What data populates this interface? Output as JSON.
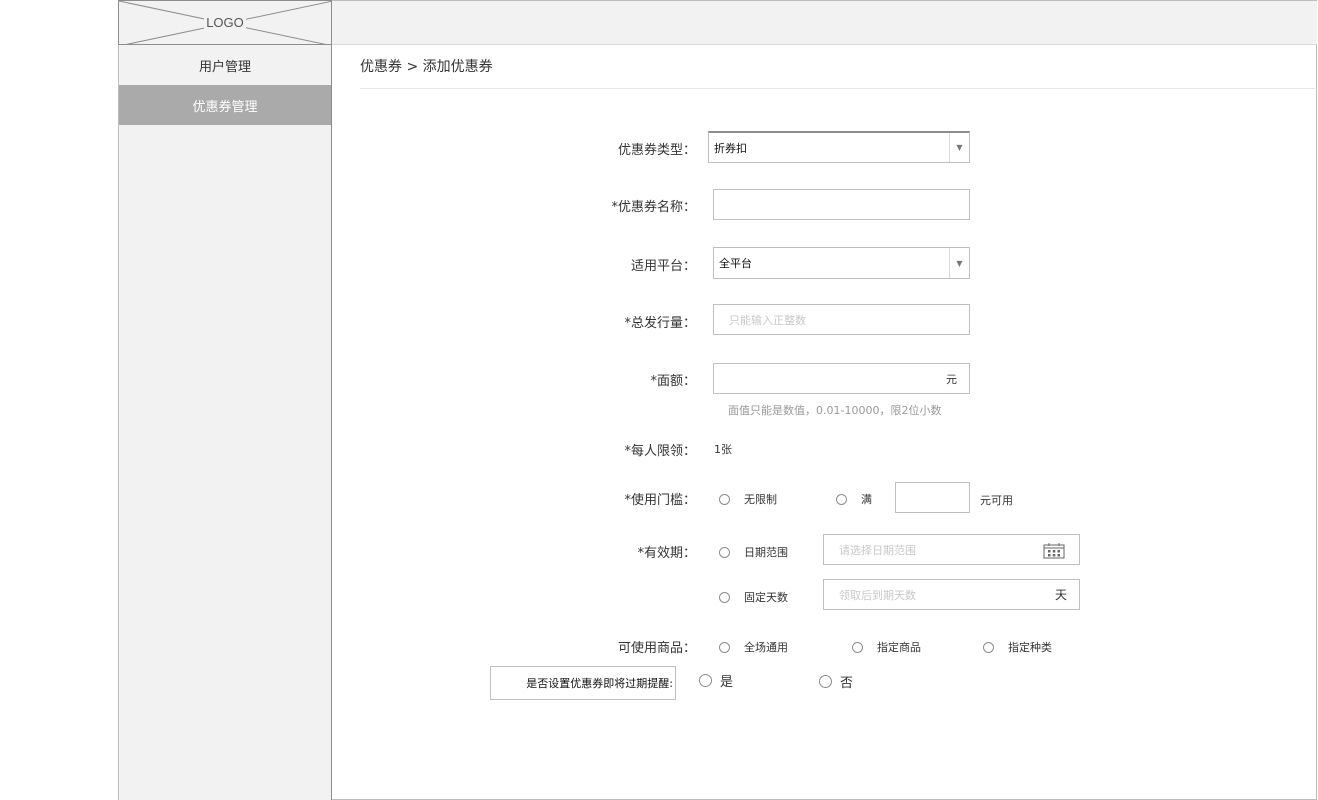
{
  "logo": {
    "text": "LOGO"
  },
  "sidebar": {
    "items": [
      {
        "label": "用户管理",
        "active": false
      },
      {
        "label": "优惠券管理",
        "active": true
      }
    ]
  },
  "breadcrumb": {
    "text": "优惠券 >  添加优惠券"
  },
  "form": {
    "coupon_type": {
      "label": "优惠券类型：",
      "value": "折券扣"
    },
    "coupon_name": {
      "label": "*优惠券名称：",
      "value": ""
    },
    "platform": {
      "label": "适用平台：",
      "value": "全平台"
    },
    "total_issue": {
      "label": "*总发行量：",
      "placeholder": "只能输入正整数"
    },
    "face_value": {
      "label": "*面额：",
      "suffix": "元",
      "hint": "面值只能是数值，0.01-10000，限2位小数"
    },
    "per_person": {
      "label": "*每人限领：",
      "value": "1张"
    },
    "threshold": {
      "label": "*使用门槛：",
      "option_unlimited": "无限制",
      "option_full": "满",
      "suffix": "元可用"
    },
    "validity": {
      "label": "*有效期：",
      "option_date_range": "日期范围",
      "date_range_placeholder": "请选择日期范围",
      "option_fixed_days": "固定天数",
      "fixed_days_placeholder": "领取后到期天数",
      "fixed_days_suffix": "天"
    },
    "goods": {
      "label": "可使用商品：",
      "option_all": "全场通用",
      "option_specific": "指定商品",
      "option_category": "指定种类"
    },
    "reminder": {
      "label": "是否设置优惠券即将过期提醒:",
      "option_yes": "是",
      "option_no": "否"
    }
  },
  "colors": {
    "sidebar_bg": "#f2f2f2",
    "sidebar_active": "#aaaaaa",
    "border": "#bfbfbf"
  },
  "icons": [
    "calendar-icon",
    "chevron-down-icon"
  ]
}
